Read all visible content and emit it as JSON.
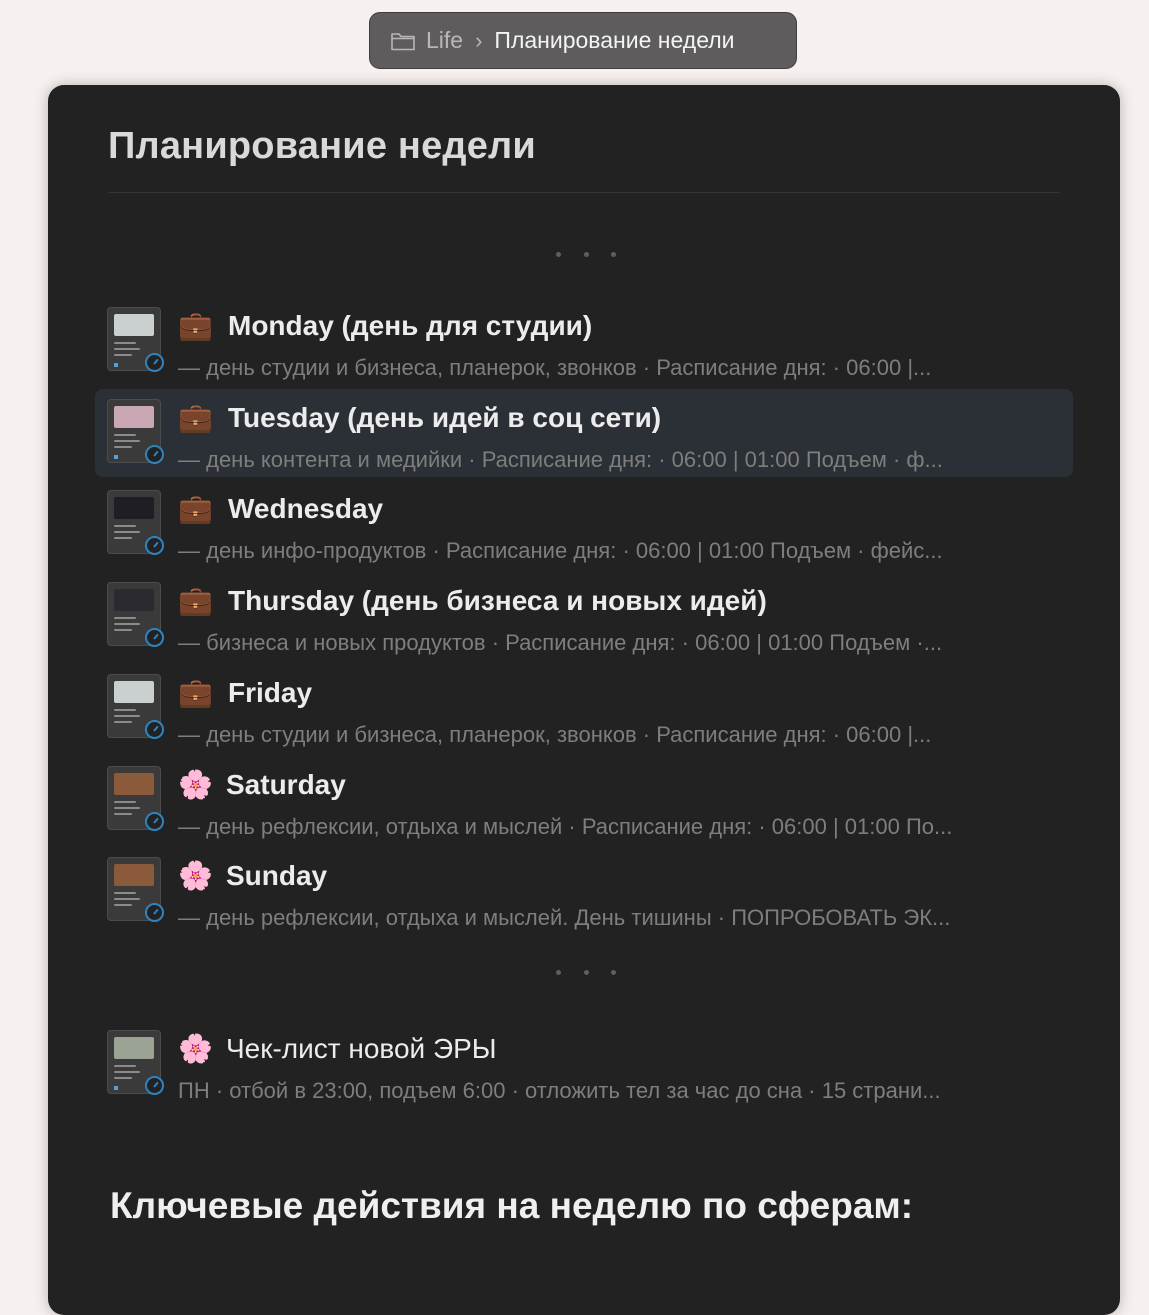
{
  "breadcrumb": {
    "root": "Life",
    "current": "Планирование недели"
  },
  "page": {
    "title": "Планирование недели"
  },
  "entries": [
    {
      "emoji": "💼",
      "title": "Monday (день для студии)",
      "subtitle": "— день студии и бизнеса, планерок, звонков · Расписание дня: · 06:00 |...",
      "thumb_color": "#c9d0cf"
    },
    {
      "emoji": "💼",
      "title": "Tuesday (день идей в соц сети)",
      "subtitle": "— день контента и медийки · Расписание дня: · 06:00 | 01:00 Подъем  · ф...",
      "thumb_color": "#c9a7b4"
    },
    {
      "emoji": "💼",
      "title": "Wednesday",
      "subtitle": "— день инфо-продуктов · Расписание дня: · 06:00 | 01:00 Подъем  · фейс...",
      "thumb_color": "#1e1e24"
    },
    {
      "emoji": "💼",
      "title": "Thursday  (день бизнеса и новых идей)",
      "subtitle": "— бизнеса и новых продуктов · Расписание дня: · 06:00 | 01:00 Подъем  ·...",
      "thumb_color": "#2a2a30"
    },
    {
      "emoji": "💼",
      "title": "Friday",
      "subtitle": "— день студии и бизнеса, планерок, звонков · Расписание дня: · 06:00 |...",
      "thumb_color": "#c9d0cf"
    },
    {
      "emoji": "🌸",
      "title": "Saturday",
      "subtitle": "— день рефлексии, отдыха и мыслей · Расписание дня: · 06:00 | 01:00 По...",
      "thumb_color": "#8a5a3a"
    },
    {
      "emoji": "🌸",
      "title": "Sunday",
      "subtitle": "— день рефлексии, отдыха и мыслей. День тишины · ПОПРОБОВАТЬ ЭК...",
      "thumb_color": "#8a5a3a"
    }
  ],
  "checklist": {
    "emoji": "🌸",
    "title": "Чек-лист новой ЭРЫ",
    "subtitle": "ПН · отбой в 23:00, подъем 6:00 · отложить тел за час до сна · 15 страни...",
    "thumb_color": "#9aa394"
  },
  "section": {
    "heading": "Ключевые действия на неделю по сферам:"
  },
  "colors": {
    "background": "#f6f0ee",
    "window": "#222222",
    "hover_row": "#2b2f36",
    "clock_accent": "#2f84c0"
  }
}
